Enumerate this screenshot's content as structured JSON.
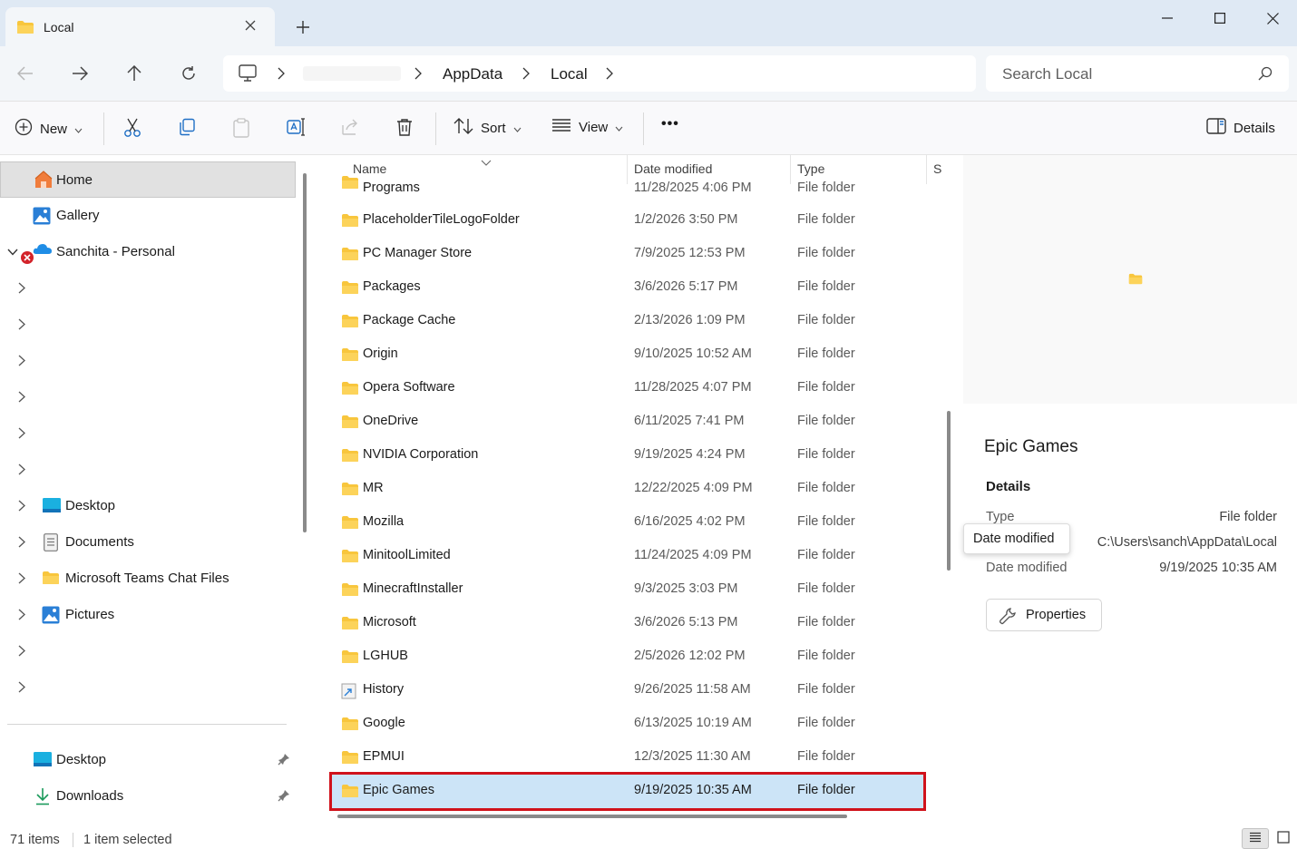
{
  "window": {
    "tab_title": "Local",
    "colors": {
      "accent": "#0067c0",
      "folder": "#f8c63d",
      "selection": "#cce4f7",
      "highlight_outline": "#d0121b"
    }
  },
  "address_bar": {
    "crumbs": [
      "AppData",
      "Local"
    ],
    "search_placeholder": "Search Local"
  },
  "toolbar": {
    "new_label": "New",
    "sort_label": "Sort",
    "view_label": "View",
    "more_label": "•••",
    "details_label": "Details"
  },
  "sidebar": {
    "home": "Home",
    "gallery": "Gallery",
    "onedrive": "Sanchita - Personal",
    "desktop": "Desktop",
    "documents": "Documents",
    "teams": "Microsoft Teams Chat Files",
    "pictures": "Pictures",
    "quick_desktop": "Desktop",
    "quick_downloads": "Downloads"
  },
  "file_list": {
    "columns": {
      "name": "Name",
      "date": "Date modified",
      "type": "Type",
      "size": "S"
    },
    "rows": [
      {
        "name": "Programs",
        "date": "11/28/2025 4:06 PM",
        "type": "File folder"
      },
      {
        "name": "PlaceholderTileLogoFolder",
        "date": "1/2/2026 3:50 PM",
        "type": "File folder"
      },
      {
        "name": "PC Manager Store",
        "date": "7/9/2025 12:53 PM",
        "type": "File folder"
      },
      {
        "name": "Packages",
        "date": "3/6/2026 5:17 PM",
        "type": "File folder"
      },
      {
        "name": "Package Cache",
        "date": "2/13/2026 1:09 PM",
        "type": "File folder"
      },
      {
        "name": "Origin",
        "date": "9/10/2025 10:52 AM",
        "type": "File folder"
      },
      {
        "name": "Opera Software",
        "date": "11/28/2025 4:07 PM",
        "type": "File folder"
      },
      {
        "name": "OneDrive",
        "date": "6/11/2025 7:41 PM",
        "type": "File folder"
      },
      {
        "name": "NVIDIA Corporation",
        "date": "9/19/2025 4:24 PM",
        "type": "File folder"
      },
      {
        "name": "MR",
        "date": "12/22/2025 4:09 PM",
        "type": "File folder"
      },
      {
        "name": "Mozilla",
        "date": "6/16/2025 4:02 PM",
        "type": "File folder"
      },
      {
        "name": "MinitoolLimited",
        "date": "11/24/2025 4:09 PM",
        "type": "File folder"
      },
      {
        "name": "MinecraftInstaller",
        "date": "9/3/2025 3:03 PM",
        "type": "File folder"
      },
      {
        "name": "Microsoft",
        "date": "3/6/2026 5:13 PM",
        "type": "File folder"
      },
      {
        "name": "LGHUB",
        "date": "2/5/2026 12:02 PM",
        "type": "File folder"
      },
      {
        "name": "History",
        "date": "9/26/2025 11:58 AM",
        "type": "File folder"
      },
      {
        "name": "Google",
        "date": "6/13/2025 10:19 AM",
        "type": "File folder"
      },
      {
        "name": "EPMUI",
        "date": "12/3/2025 11:30 AM",
        "type": "File folder"
      },
      {
        "name": "Epic Games",
        "date": "9/19/2025 10:35 AM",
        "type": "File folder"
      }
    ]
  },
  "details_pane": {
    "title": "Epic Games",
    "section": "Details",
    "type_label": "Type",
    "type_value": "File folder",
    "location_value": "C:\\Users\\sanch\\AppData\\Local",
    "date_label": "Date modified",
    "date_value": "9/19/2025 10:35 AM",
    "tooltip": "Date modified",
    "properties_label": "Properties"
  },
  "status_bar": {
    "item_count": "71 items",
    "selection": "1 item selected"
  }
}
